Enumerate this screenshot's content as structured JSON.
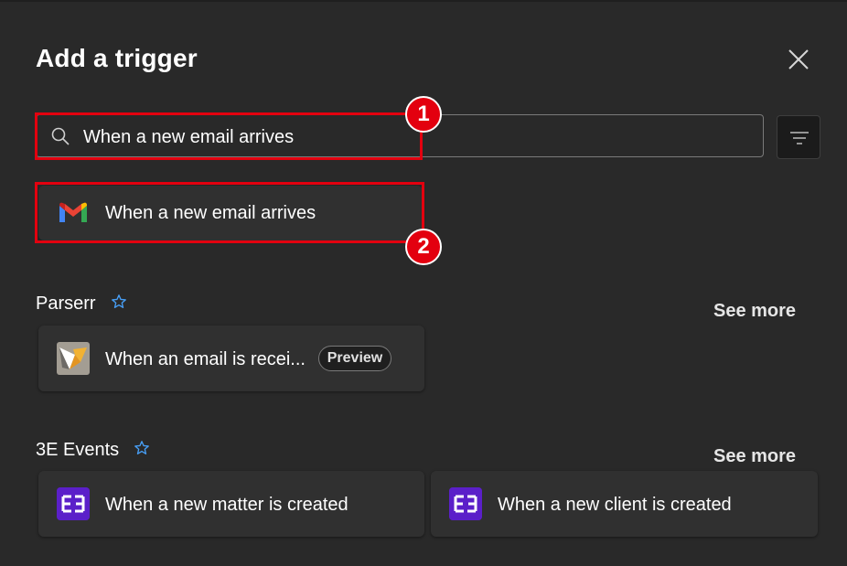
{
  "panel": {
    "title": "Add a trigger",
    "close_icon": "close-icon"
  },
  "search": {
    "value": "When a new email arrives",
    "icon": "search-icon",
    "filter_icon": "filter-icon"
  },
  "annotations": {
    "badge1": "1",
    "badge2": "2",
    "highlight_color": "#e3000f"
  },
  "result": {
    "label": "When a new email arrives",
    "logo": "gmail-logo"
  },
  "sections": [
    {
      "title": "Parserr",
      "see_more": "See more",
      "items": [
        {
          "label": "When an email is recei...",
          "badge": "Preview",
          "logo": "parserr-logo"
        }
      ]
    },
    {
      "title": "3E Events",
      "see_more": "See more",
      "items": [
        {
          "label": "When a new matter is created",
          "logo": "3e-logo"
        },
        {
          "label": "When a new client is created",
          "logo": "3e-logo"
        }
      ]
    }
  ],
  "colors": {
    "background": "#292929",
    "card": "#303030",
    "accent_star": "#479ef5",
    "e3_brand": "#5b1fc9"
  }
}
